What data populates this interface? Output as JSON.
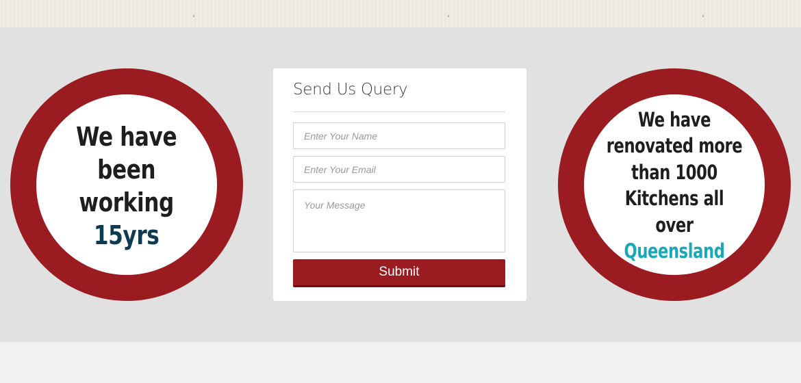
{
  "badges": {
    "left": {
      "line1": "We have",
      "line2": "been",
      "line3": "working",
      "highlight": "15yrs"
    },
    "right": {
      "line1": "We have",
      "line2": "renovated more",
      "line3": "than 1000",
      "line4": "Kitchens all over",
      "highlight": "Queensland"
    }
  },
  "form": {
    "title": "Send Us Query",
    "name_placeholder": "Enter Your Name",
    "email_placeholder": "Enter Your Email",
    "message_placeholder": "Your Message",
    "submit_label": "Submit"
  },
  "colors": {
    "accent_red": "#9b1c20",
    "highlight_dark": "#0e3a52",
    "highlight_teal": "#1aa8b8",
    "band_gray": "#e1e1e1"
  }
}
